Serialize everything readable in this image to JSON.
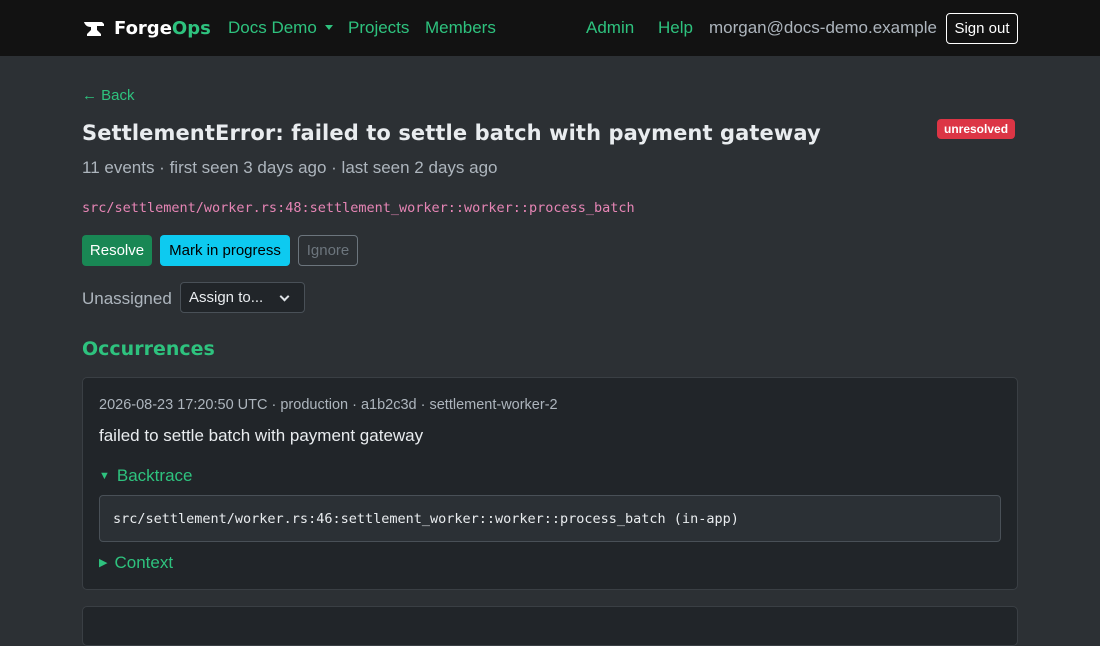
{
  "nav": {
    "brand_prefix": "Forge",
    "brand_suffix": "Ops",
    "org_label": "Docs Demo",
    "projects_label": "Projects",
    "members_label": "Members",
    "admin_label": "Admin",
    "help_label": "Help",
    "user_email": "morgan@docs-demo.example",
    "signout_label": "Sign out"
  },
  "issue": {
    "back_label": "← Back",
    "title": "SettlementError: failed to settle batch with payment gateway",
    "status_badge": "unresolved",
    "meta": "11 events · first seen 3 days ago · last seen 2 days ago",
    "culprit": "src/settlement/worker.rs:48:settlement_worker::worker::process_batch",
    "actions": {
      "resolve_label": "Resolve",
      "progress_label": "Mark in progress",
      "ignore_label": "Ignore"
    },
    "assignee_label": "Unassigned",
    "assign_select_value": "Assign to..."
  },
  "occurrences": {
    "heading": "Occurrences",
    "items": [
      {
        "meta": "2026-08-23 17:20:50 UTC · production · a1b2c3d · settlement-worker-2",
        "message": "failed to settle batch with payment gateway",
        "backtrace_label": "Backtrace",
        "backtrace_frame": "src/settlement/worker.rs:46:settlement_worker::worker::process_batch (in-app)",
        "context_label": "Context"
      }
    ]
  },
  "colors": {
    "accent": "#2ec27e",
    "navbar_bg": "#121212",
    "page_bg": "#2c3034",
    "danger": "#dc3545",
    "success": "#198754",
    "info": "#0dcaf0",
    "code_pink": "#e685b5"
  },
  "icons": {
    "brand": "anvil-icon",
    "org_menu": "caret-down-icon",
    "assign_menu": "chevron-down-icon",
    "backtrace_toggle": "triangle-down-icon",
    "context_toggle": "triangle-right-icon"
  }
}
